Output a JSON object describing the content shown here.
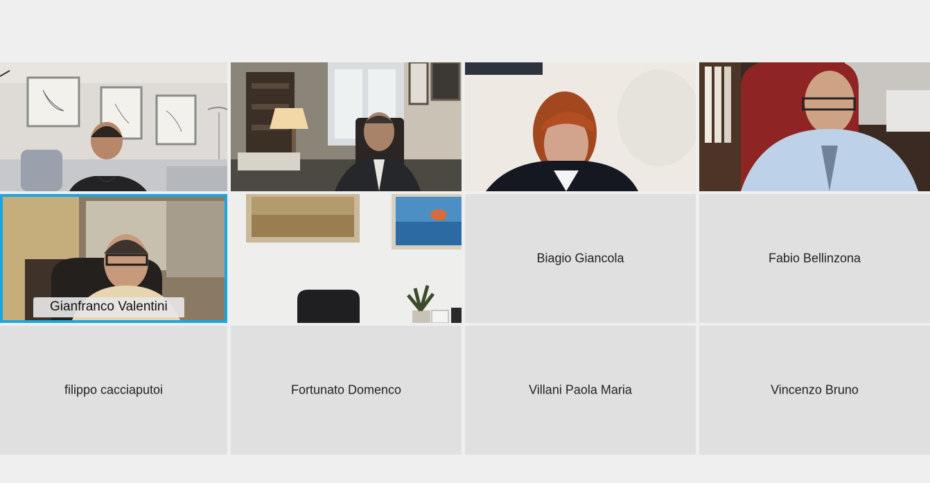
{
  "meeting": {
    "active_speaker": "Gianfranco Valentini",
    "participants_with_video": [
      {
        "id": "p1",
        "icon": "video-feed-woman-living-room"
      },
      {
        "id": "p2",
        "icon": "video-feed-man-study"
      },
      {
        "id": "p3",
        "icon": "video-feed-woman-red-hair"
      },
      {
        "id": "p4",
        "icon": "video-feed-man-red-chair"
      },
      {
        "id": "p5",
        "label": "Gianfranco Valentini",
        "icon": "video-feed-man-office"
      },
      {
        "id": "p6",
        "icon": "video-feed-empty-office"
      }
    ],
    "participants_no_video": [
      {
        "label": "Biagio Giancola"
      },
      {
        "label": "Fabio Bellinzona"
      },
      {
        "label": "filippo cacciaputoi"
      },
      {
        "label": "Fortunato Domenco"
      },
      {
        "label": "Villani Paola Maria"
      },
      {
        "label": "Vincenzo Bruno"
      }
    ]
  },
  "colors": {
    "background": "#efefef",
    "tile_placeholder": "#e0e0e0",
    "active_border": "#18a7e0"
  }
}
